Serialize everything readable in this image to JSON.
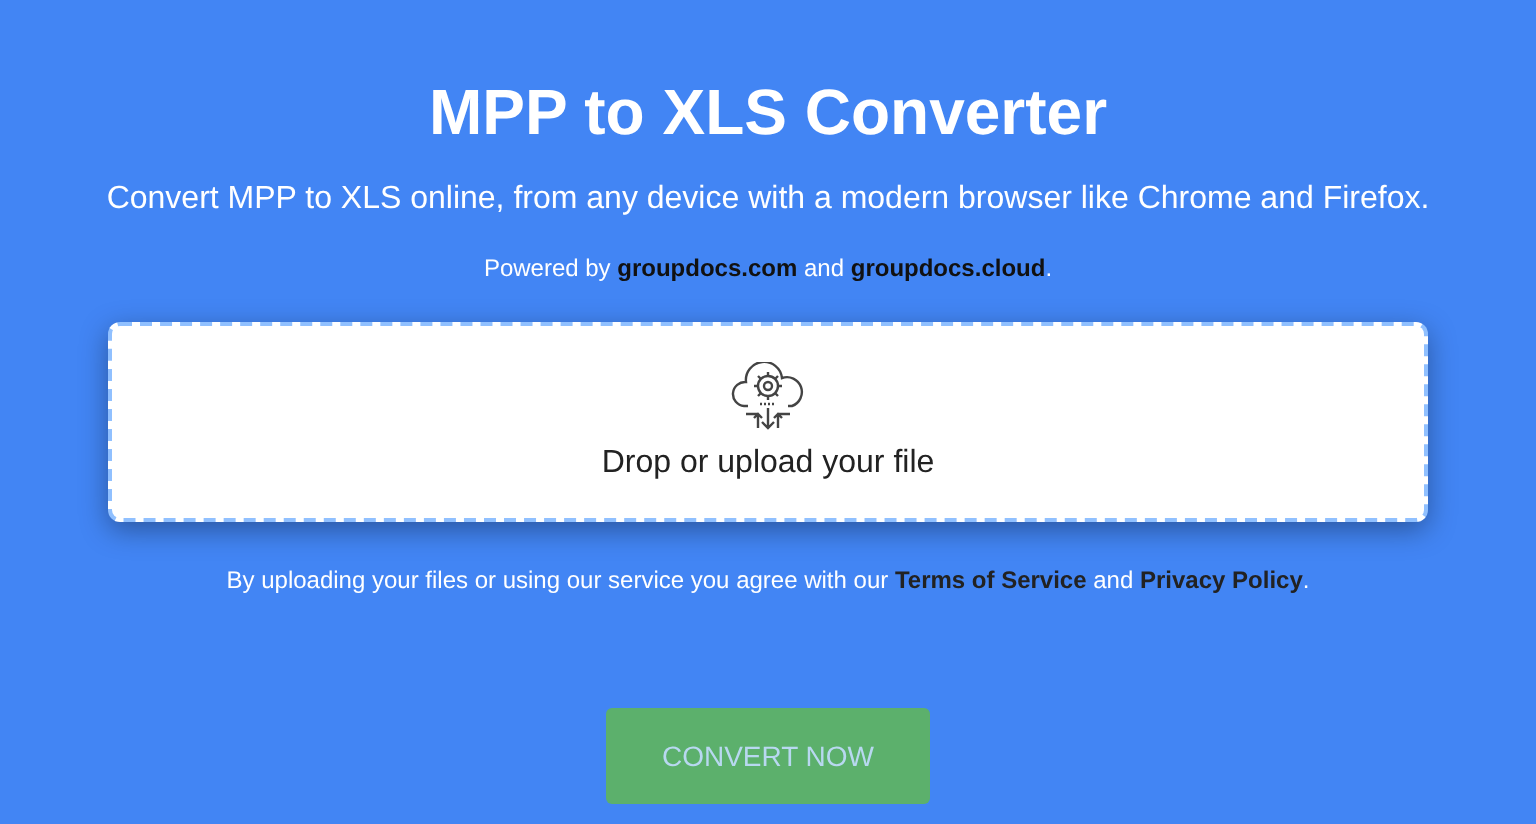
{
  "title": "MPP to XLS Converter",
  "subtitle": "Convert MPP to XLS online, from any device with a modern browser like Chrome and Firefox.",
  "powered_by": {
    "prefix": "Powered by ",
    "links": [
      "groupdocs.com",
      "groupdocs.cloud"
    ],
    "joiner": " and ",
    "suffix": "."
  },
  "upload": {
    "label": "Drop or upload your file"
  },
  "agreement": {
    "prefix": "By uploading your files or using our service you agree with our ",
    "links": [
      "Terms of Service",
      "Privacy Policy"
    ],
    "joiner": " and ",
    "suffix": "."
  },
  "convert_button": {
    "label": "CONVERT NOW",
    "disabled": true
  }
}
